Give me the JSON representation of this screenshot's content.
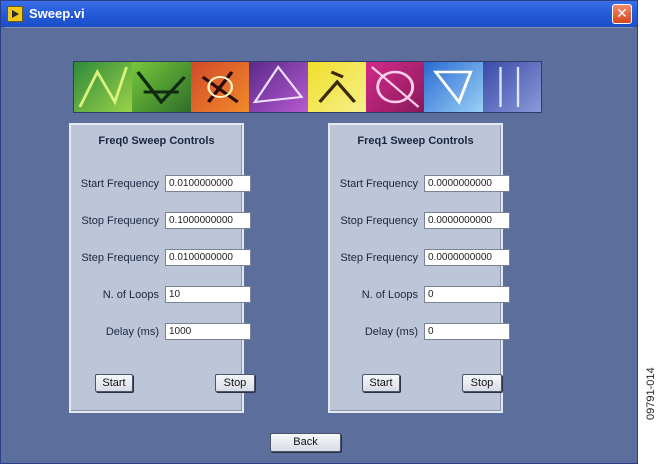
{
  "window": {
    "title": "Sweep.vi",
    "close_symbol": "✕"
  },
  "panels": [
    {
      "title": "Freq0 Sweep Controls",
      "fields": [
        {
          "label": "Start Frequency",
          "value": "0.0100000000"
        },
        {
          "label": "Stop Frequency",
          "value": "0.1000000000"
        },
        {
          "label": "Step Frequency",
          "value": "0.0100000000"
        },
        {
          "label": "N. of Loops",
          "value": "10"
        },
        {
          "label": "Delay (ms)",
          "value": "1000"
        }
      ],
      "start_label": "Start",
      "stop_label": "Stop"
    },
    {
      "title": "Freq1 Sweep Controls",
      "fields": [
        {
          "label": "Start Frequency",
          "value": "0.0000000000"
        },
        {
          "label": "Stop Frequency",
          "value": "0.0000000000"
        },
        {
          "label": "Step Frequency",
          "value": "0.0000000000"
        },
        {
          "label": "N. of Loops",
          "value": "0"
        },
        {
          "label": "Delay (ms)",
          "value": "0"
        }
      ],
      "start_label": "Start",
      "stop_label": "Stop"
    }
  ],
  "back_label": "Back",
  "figure_id": "09791-014",
  "colors": {
    "titlebar": "#2358d8",
    "background": "#5b6e9c",
    "panel": "#bcc6d8",
    "close": "#d8461e"
  }
}
